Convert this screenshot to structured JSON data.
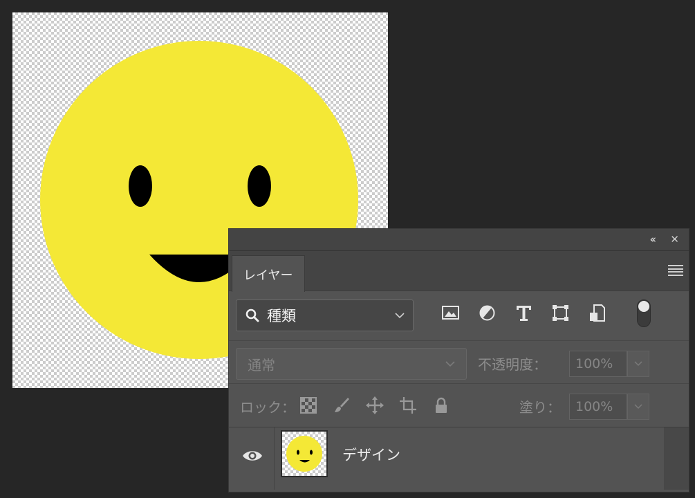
{
  "canvas": {
    "artwork": "smiley-face",
    "face_color": "#F4E836",
    "feature_color": "#000000"
  },
  "panel": {
    "collapse_label": "‹‹",
    "close_label": "✕",
    "tab_label": "レイヤー",
    "menu_icon": "hamburger-menu-icon",
    "filter": {
      "kind_label": "種類",
      "icons": [
        "image-filter-icon",
        "adjustment-filter-icon",
        "type-filter-icon",
        "shape-filter-icon",
        "smart-object-filter-icon"
      ],
      "toggle_on": true
    },
    "blend": {
      "mode": "通常",
      "opacity_label": "不透明度：",
      "opacity_value": "100%"
    },
    "lock": {
      "label": "ロック：",
      "icons": [
        "lock-transparent-pixels-icon",
        "lock-image-pixels-icon",
        "lock-position-icon",
        "lock-artboard-icon",
        "lock-all-icon"
      ],
      "fill_label": "塗り：",
      "fill_value": "100%"
    },
    "layers": [
      {
        "name": "デザイン",
        "visible": true
      }
    ]
  },
  "colors": {
    "app_bg": "#262626",
    "panel_bg": "#535353",
    "face": "#F4E836"
  }
}
